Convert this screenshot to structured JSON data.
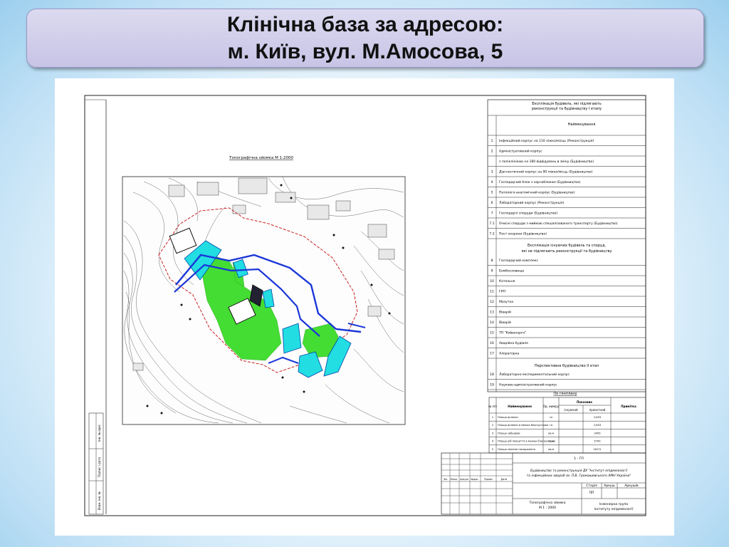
{
  "slide": {
    "title_line1": "Клінічна база за адресою:",
    "title_line2": "м. Київ, вул. М.Амосова, 5"
  },
  "drawing": {
    "map_caption": "Топографічна зйомка М 1:2000",
    "explication_header_1": "Експлікація будівель, які підлягають",
    "explication_header_2": "реконструкції та будівництву І етапу",
    "name_header": "Найменування",
    "rows_stage1": [
      {
        "no": "1",
        "name": "Інфекційний корпус на 110 ліжко/місць (Реконструкція)"
      },
      {
        "no": "2",
        "name": "Адміністративний корпус"
      },
      {
        "no": "",
        "name": "з поліклінікою на 180 відвідувань в зміну (Будівництво)"
      },
      {
        "no": "3",
        "name": "Діагностичний корпус на 90 ліжко/місць (Будівництво)"
      },
      {
        "no": "4",
        "name": "Господарчий блок з харчоблоком (Будівництво)"
      },
      {
        "no": "5",
        "name": "Патолого-анатомічний корпус (Будівництво)"
      },
      {
        "no": "6",
        "name": "Лабораторний корпус (Реконструкція)"
      },
      {
        "no": "7",
        "name": "Господарчі споруди (Будівництво)"
      },
      {
        "no": "7.1",
        "name": "Очисні споруди з мийкою спеціалізованого транспорту (Будівництво)"
      },
      {
        "no": "7.2",
        "name": "Пост охорони (Будівництво)"
      }
    ],
    "existing_header_1": "Експлікація існуючих будівель та споруд,",
    "existing_header_2": "які не підлягають реконструкції та будівництву",
    "rows_existing": [
      {
        "no": "8",
        "name": "Господарчий комплекс"
      },
      {
        "no": "9",
        "name": "Бомбосховище"
      },
      {
        "no": "10",
        "name": "Котельня"
      },
      {
        "no": "11",
        "name": "ГРП"
      },
      {
        "no": "12",
        "name": "Мазутна"
      },
      {
        "no": "13",
        "name": "Віварій"
      },
      {
        "no": "14",
        "name": "Віварій"
      },
      {
        "no": "15",
        "name": "ТП \"Київенерго\""
      },
      {
        "no": "16",
        "name": "Аварійна будівля"
      },
      {
        "no": "17",
        "name": "Хлораторна"
      }
    ],
    "prospective_header": "Перспективне будівництво ІІ етап",
    "rows_prospective": [
      {
        "no": "18",
        "name": "Лабораторно-експериментальний корпус"
      },
      {
        "no": "19",
        "name": "Науково-адміністративний корпус"
      }
    ],
    "genplan_title": "По генплану",
    "indicators_headers": {
      "no": "№ п/п",
      "name": "Найменування",
      "unit": "Од. виміру",
      "indicators": "Показник",
      "existing": "існуючий",
      "project": "проектний",
      "note": "Примітка"
    },
    "indicators": [
      {
        "no": "1",
        "name": "Площа ділянки",
        "unit": "га",
        "existing": "",
        "project": "2,633"
      },
      {
        "no": "2",
        "name": "Площа ділянки в межах благоустрою",
        "unit": "га",
        "existing": "",
        "project": "2,633"
      },
      {
        "no": "3",
        "name": "Площа забудови",
        "unit": "кв.м",
        "existing": "",
        "project": "3459"
      },
      {
        "no": "4",
        "name": "Площа a/б покриття в межах благоустрою",
        "unit": "кв.м",
        "existing": "",
        "project": "5700"
      },
      {
        "no": "5",
        "name": "Площа зеленої насадження",
        "unit": "кв.м",
        "existing": "",
        "project": "16171"
      }
    ],
    "stamp": {
      "code": "1 - ГП",
      "project_1": "Будівництво та реконструкція ДУ \"Інститут епідеміології",
      "project_2": "та інфекційних хвороб ім. Л.В. Громашевського АМН України\"",
      "col_labels": [
        "Зм.",
        "Кільк.",
        "Аркуш",
        "№док.",
        "Підпис",
        "Дата"
      ],
      "stage_label": "Стадія",
      "sheet_label": "Аркуш",
      "sheets_label": "Аркушів",
      "stage_value": "ПП",
      "sheet_title_1": "Топографічна зйомка",
      "sheet_title_2": "М 1 : 2000",
      "org_1": "Інженерна група",
      "org_2": "Інституту епідеміології"
    },
    "side_labels": [
      "Інв. № ориг.",
      "Підпис і дата",
      "Взам. інв. №"
    ]
  }
}
